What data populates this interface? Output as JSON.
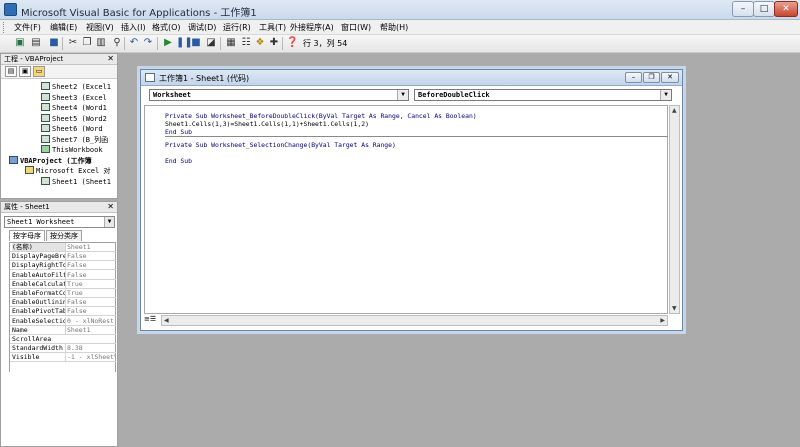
{
  "window": {
    "title": "Microsoft Visual Basic for Applications - 工作簿1"
  },
  "menu": [
    "文件(F)",
    "编辑(E)",
    "视图(V)",
    "插入(I)",
    "格式(O)",
    "调试(D)",
    "运行(R)",
    "工具(T)",
    "外接程序(A)",
    "窗口(W)",
    "帮助(H)"
  ],
  "toolbar": {
    "status": "行 3，列 54"
  },
  "project_panel": {
    "title": "工程 - VBAProject",
    "tree": [
      {
        "label": "Sheet2 (Excel1",
        "indent": 2,
        "icon": "sheet"
      },
      {
        "label": "Sheet3 (Excel",
        "indent": 2,
        "icon": "sheet"
      },
      {
        "label": "Sheet4 (Word1",
        "indent": 2,
        "icon": "sheet"
      },
      {
        "label": "Sheet5 (Word2",
        "indent": 2,
        "icon": "sheet"
      },
      {
        "label": "Sheet6 (Word",
        "indent": 2,
        "icon": "sheet"
      },
      {
        "label": "Sheet7 (B_列函",
        "indent": 2,
        "icon": "sheet"
      },
      {
        "label": "ThisWorkbook",
        "indent": 2,
        "icon": "workbook"
      },
      {
        "label": "VBAProject (工作簿",
        "indent": 0,
        "icon": "project",
        "bold": true
      },
      {
        "label": "Microsoft Excel 对",
        "indent": 1,
        "icon": "folder"
      },
      {
        "label": "Sheet1 (Sheet1",
        "indent": 2,
        "icon": "sheet"
      }
    ]
  },
  "properties_panel": {
    "title": "属性 - Sheet1",
    "object": "Sheet1 Worksheet",
    "tabs": [
      "按字母序",
      "按分类序"
    ],
    "rows": [
      {
        "key": "(名称)",
        "value": "Sheet1"
      },
      {
        "key": "DisplayPageBre",
        "value": "False"
      },
      {
        "key": "DisplayRightTo",
        "value": "False"
      },
      {
        "key": "EnableAutoFilt",
        "value": "False"
      },
      {
        "key": "EnableCalculat",
        "value": "True"
      },
      {
        "key": "EnableFormatCo",
        "value": "True"
      },
      {
        "key": "EnableOutlinin",
        "value": "False"
      },
      {
        "key": "EnablePivotTab",
        "value": "False"
      },
      {
        "key": "EnableSelectio",
        "value": "0 - xlNoRestr"
      },
      {
        "key": "Name",
        "value": "Sheet1"
      },
      {
        "key": "ScrollArea",
        "value": ""
      },
      {
        "key": "StandardWidth",
        "value": "8.38"
      },
      {
        "key": "Visible",
        "value": "-1 - xlSheetV"
      }
    ]
  },
  "code_window": {
    "title": "工作簿1 - Sheet1 (代码)",
    "object_combo": "Worksheet",
    "proc_combo": "BeforeDoubleClick",
    "lines_proc1": [
      "Private Sub Worksheet_BeforeDoubleClick(ByVal Target As Range, Cancel As Boolean)",
      "Sheet1.Cells(1,3)=Sheet1.Cells(1,1)+Sheet1.Cells(1,2)",
      "End Sub"
    ],
    "lines_proc2": [
      "Private Sub Worksheet_SelectionChange(ByVal Target As Range)",
      "",
      "End Sub"
    ]
  },
  "colors": {
    "workspace": "#ababab",
    "code_keyword": "#00007b",
    "window_frame": "#c6d7ea"
  }
}
